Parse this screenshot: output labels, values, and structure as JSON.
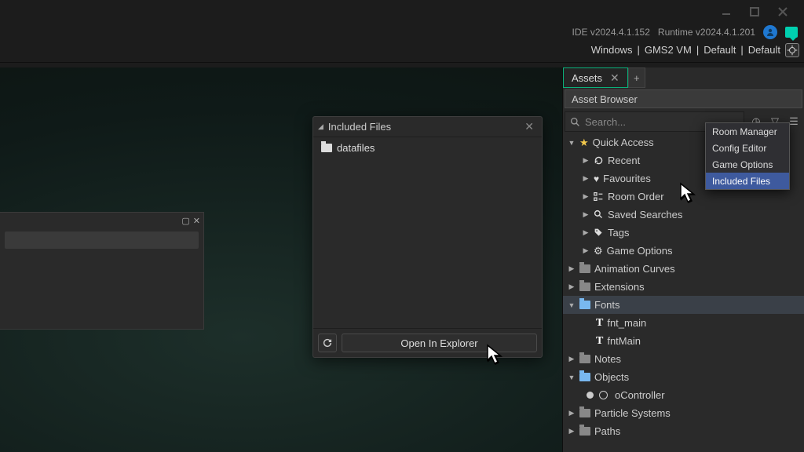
{
  "version": {
    "ide": "IDE v2024.4.1.152",
    "runtime": "Runtime v2024.4.1.201"
  },
  "toolbar": {
    "windows": "Windows",
    "gms2vm": "GMS2 VM",
    "default1": "Default",
    "default2": "Default"
  },
  "included_panel": {
    "title": "Included Files",
    "folder": "datafiles",
    "open_btn": "Open In Explorer"
  },
  "asset_panel": {
    "tab": "Assets",
    "title": "Asset Browser",
    "search_placeholder": "Search...",
    "quick_access": "Quick Access",
    "qa_items": {
      "recent": "Recent",
      "favourites": "Favourites",
      "room_order": "Room Order",
      "saved": "Saved Searches",
      "tags": "Tags",
      "game_opts": "Game Options"
    },
    "folders": {
      "anim": "Animation Curves",
      "ext": "Extensions",
      "fonts": "Fonts",
      "font1": "fnt_main",
      "font2": "fntMain",
      "notes": "Notes",
      "objects": "Objects",
      "obj1": "oController",
      "particles": "Particle Systems",
      "paths": "Paths"
    }
  },
  "context_menu": {
    "room": "Room Manager",
    "config": "Config Editor",
    "game": "Game Options",
    "included": "Included Files"
  }
}
